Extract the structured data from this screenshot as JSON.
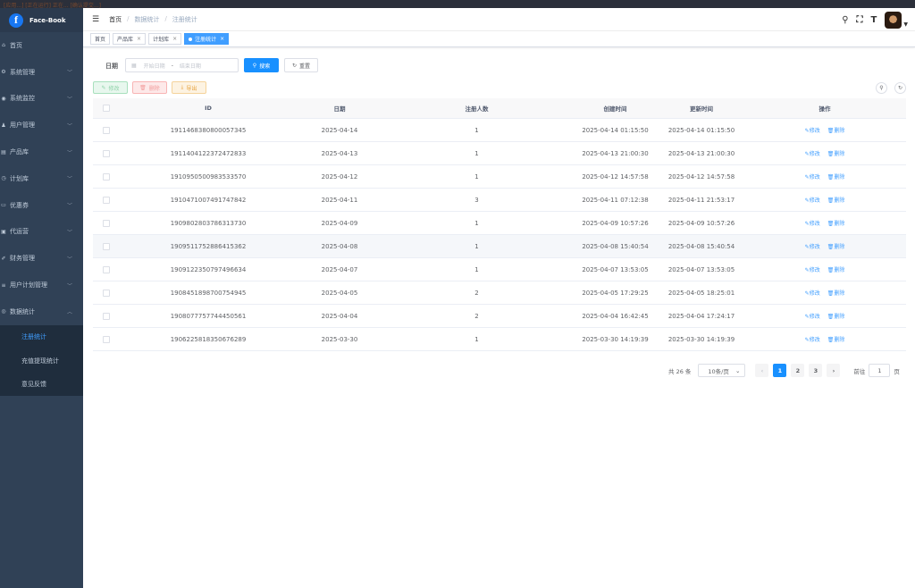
{
  "topstrip_text": "[应用...] [正在运行] 正在...  [确认提交...]",
  "app": {
    "name": "Face-Book",
    "logo_letter": "f"
  },
  "sidebar": {
    "items": [
      {
        "label": "首页",
        "icon": "home-icon"
      },
      {
        "label": "系统管理",
        "icon": "gear-icon"
      },
      {
        "label": "系统监控",
        "icon": "monitor-icon"
      },
      {
        "label": "用户管理",
        "icon": "user-icon"
      },
      {
        "label": "产品库",
        "icon": "cart-icon"
      },
      {
        "label": "计划库",
        "icon": "plan-icon"
      },
      {
        "label": "优惠券",
        "icon": "coupon-icon"
      },
      {
        "label": "代运营",
        "icon": "operation-icon"
      },
      {
        "label": "财务管理",
        "icon": "finance-icon"
      },
      {
        "label": "用户计划管理",
        "icon": "list-icon"
      },
      {
        "label": "数据统计",
        "icon": "stats-icon"
      }
    ],
    "subitems": [
      {
        "label": "注册统计",
        "active": true
      },
      {
        "label": "充值提现统计",
        "active": false
      },
      {
        "label": "意见反馈",
        "active": false
      }
    ]
  },
  "breadcrumb": [
    "首页",
    "数据统计",
    "注册统计"
  ],
  "tags": [
    {
      "label": "首页",
      "closable": false,
      "active": false
    },
    {
      "label": "产品库",
      "closable": true,
      "active": false
    },
    {
      "label": "计划库",
      "closable": true,
      "active": false
    },
    {
      "label": "注册统计",
      "closable": true,
      "active": true
    }
  ],
  "search": {
    "date_label": "日期",
    "start_placeholder": "开始日期",
    "range_separator": "-",
    "end_placeholder": "结束日期",
    "search_btn": "搜索",
    "reset_btn": "重置"
  },
  "toolbar": {
    "edit": "修改",
    "delete": "删除",
    "export": "导出"
  },
  "table": {
    "headers": [
      "ID",
      "日期",
      "注册人数",
      "创建时间",
      "更新时间",
      "操作"
    ],
    "rows": [
      [
        "1911468380800057345",
        "2025-04-14",
        "1",
        "2025-04-14 01:15:50",
        "2025-04-14 01:15:50"
      ],
      [
        "1911404122372472833",
        "2025-04-13",
        "1",
        "2025-04-13 21:00:30",
        "2025-04-13 21:00:30"
      ],
      [
        "1910950500983533570",
        "2025-04-12",
        "1",
        "2025-04-12 14:57:58",
        "2025-04-12 14:57:58"
      ],
      [
        "1910471007491747842",
        "2025-04-11",
        "3",
        "2025-04-11 07:12:38",
        "2025-04-11 21:53:17"
      ],
      [
        "1909802803786313730",
        "2025-04-09",
        "1",
        "2025-04-09 10:57:26",
        "2025-04-09 10:57:26"
      ],
      [
        "1909511752886415362",
        "2025-04-08",
        "1",
        "2025-04-08 15:40:54",
        "2025-04-08 15:40:54"
      ],
      [
        "1909122350797496634",
        "2025-04-07",
        "1",
        "2025-04-07 13:53:05",
        "2025-04-07 13:53:05"
      ],
      [
        "1908451898700754945",
        "2025-04-05",
        "2",
        "2025-04-05 17:29:25",
        "2025-04-05 18:25:01"
      ],
      [
        "1908077757744450561",
        "2025-04-04",
        "2",
        "2025-04-04 16:42:45",
        "2025-04-04 17:24:17"
      ],
      [
        "1906225818350676289",
        "2025-03-30",
        "1",
        "2025-03-30 14:19:39",
        "2025-03-30 14:19:39"
      ]
    ],
    "row_actions": {
      "edit": "修改",
      "delete": "删除"
    },
    "hover_row_index": 5
  },
  "pagination": {
    "total": "共 26 条",
    "page_size": "10条/页",
    "pages": [
      "1",
      "2",
      "3"
    ],
    "current": "1",
    "goto_label": "前往",
    "goto_value": "1",
    "goto_suffix": "页"
  }
}
